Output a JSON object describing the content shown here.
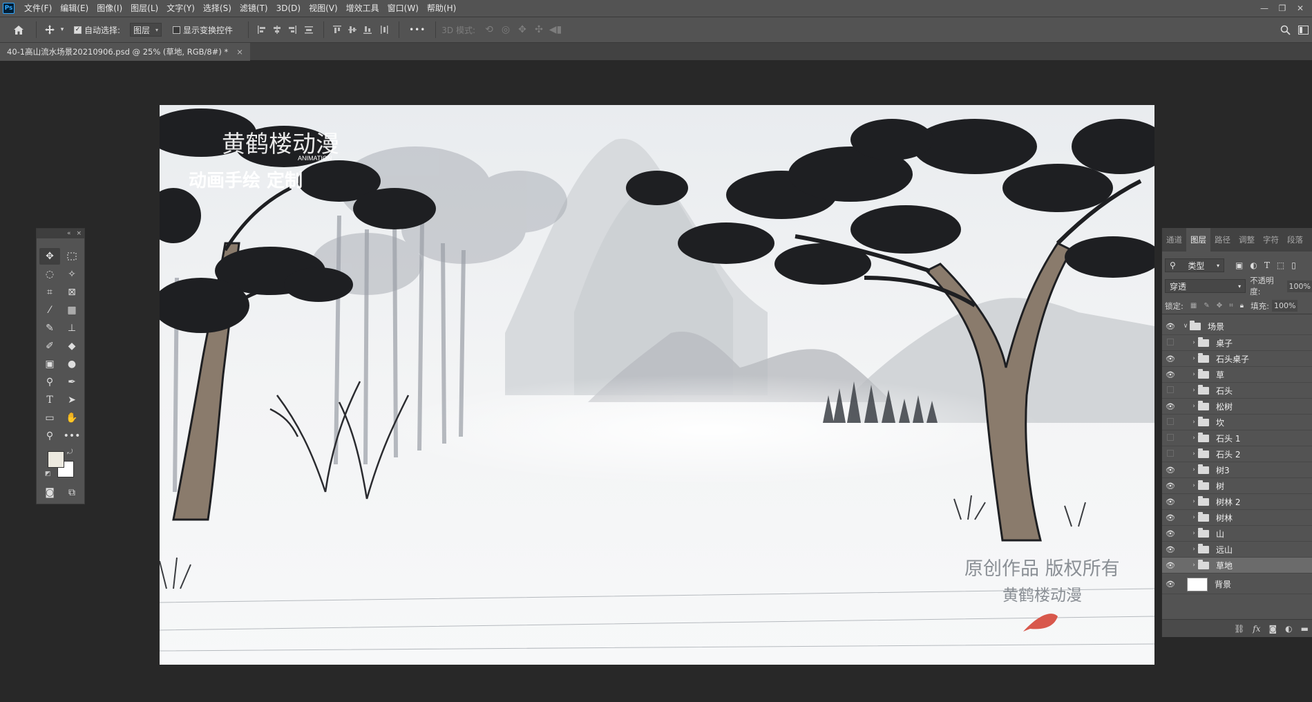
{
  "app": {
    "logo": "Ps",
    "menu": [
      "文件(F)",
      "编辑(E)",
      "图像(I)",
      "图层(L)",
      "文字(Y)",
      "选择(S)",
      "滤镜(T)",
      "3D(D)",
      "视图(V)",
      "增效工具",
      "窗口(W)",
      "帮助(H)"
    ],
    "window_controls": [
      "—",
      "❐",
      "✕"
    ]
  },
  "options": {
    "auto_select_label": "自动选择:",
    "auto_select_value": "图层",
    "show_transform_label": "显示变换控件",
    "mode_3d_label": "3D 模式:",
    "more": "•••"
  },
  "document": {
    "tab_title": "40-1高山流水场景20210906.psd @ 25% (草地, RGB/8#) *",
    "close": "×"
  },
  "artwork": {
    "logo_text": "黄鹤楼动漫",
    "logo_sub": "ANIMATION",
    "slogan": "动画手绘  定制",
    "watermark_line1": "原创作品 版权所有",
    "watermark_line2": "黄鹤楼动漫",
    "colors": {
      "sky": "#f4f5f6",
      "pine_dark": "#1e1f22",
      "trunk": "#8a7b6c",
      "mountain": "#c9ccd0"
    }
  },
  "tools_panel": {
    "collapse": "«",
    "close": "×",
    "foreground_color": "#ece9df",
    "background_color": "#ffffff"
  },
  "layers_panel": {
    "tabs": [
      "通道",
      "图层",
      "路径",
      "调整",
      "字符",
      "段落"
    ],
    "active_tab": "图层",
    "filter_kind": "类型",
    "blend_mode": "穿透",
    "opacity_label": "不透明度:",
    "opacity_value": "100%",
    "lock_label": "锁定:",
    "fill_label": "填充:",
    "fill_value": "100%",
    "group": {
      "name": "场景",
      "visible": true
    },
    "layers": [
      {
        "name": "桌子",
        "visible": false
      },
      {
        "name": "石头桌子",
        "visible": true
      },
      {
        "name": "草",
        "visible": true
      },
      {
        "name": "石头",
        "visible": false
      },
      {
        "name": "松树",
        "visible": true
      },
      {
        "name": "坎",
        "visible": false
      },
      {
        "name": "石头 1",
        "visible": false
      },
      {
        "name": "石头 2",
        "visible": false
      },
      {
        "name": "树3",
        "visible": true
      },
      {
        "name": "树",
        "visible": true
      },
      {
        "name": "树林 2",
        "visible": true
      },
      {
        "name": "树林",
        "visible": true
      },
      {
        "name": "山",
        "visible": true
      },
      {
        "name": "远山",
        "visible": true
      },
      {
        "name": "草地",
        "visible": true,
        "selected": true
      }
    ],
    "background_layer": {
      "name": "背景",
      "visible": true
    },
    "footer_icons": [
      "link-icon",
      "fx-icon",
      "mask-icon",
      "adjustment-icon",
      "new-group-icon"
    ]
  }
}
